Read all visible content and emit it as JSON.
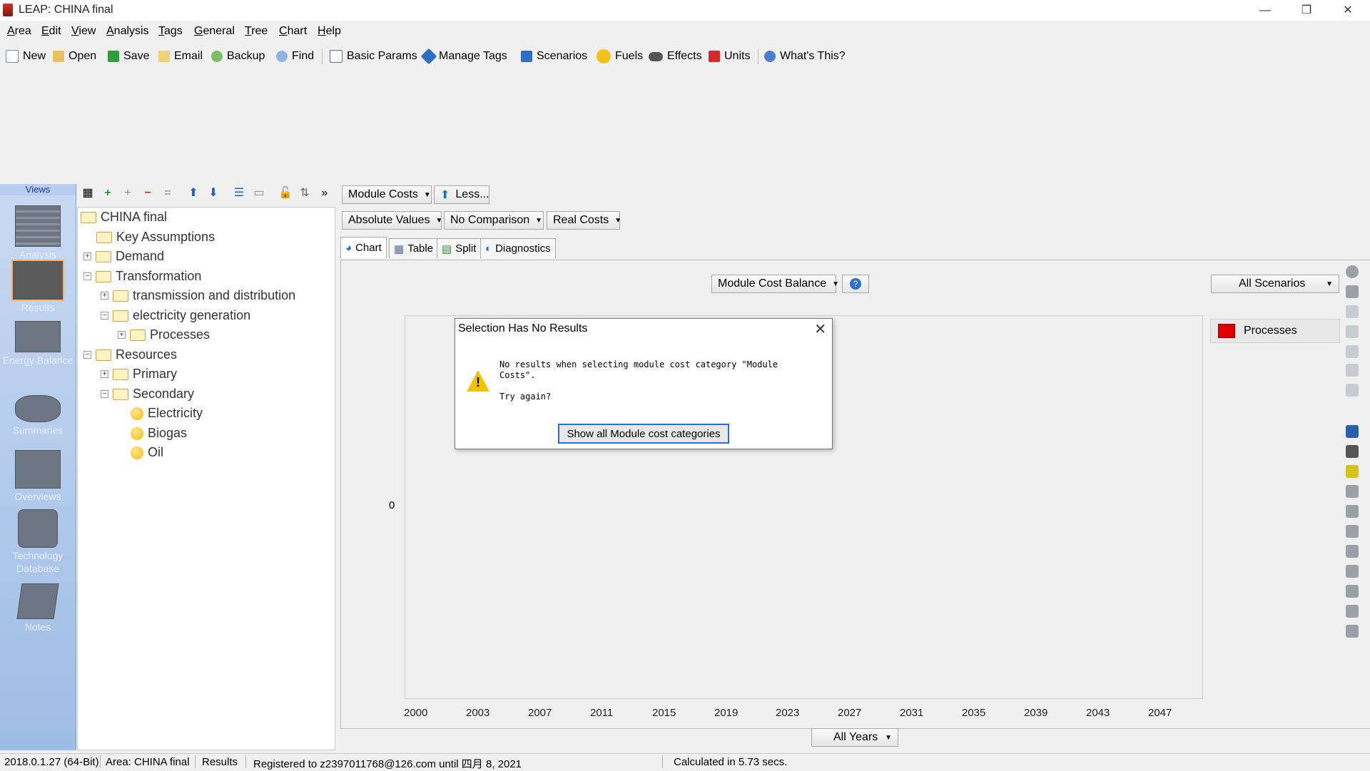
{
  "window": {
    "title": "LEAP: CHINA final",
    "minimize": "—",
    "restore": "❐",
    "close": "✕"
  },
  "menu": [
    "Area",
    "Edit",
    "View",
    "Analysis",
    "Tags",
    "General",
    "Tree",
    "Chart",
    "Help"
  ],
  "toolbar": {
    "new": "New",
    "open": "Open",
    "save": "Save",
    "email": "Email",
    "backup": "Backup",
    "find": "Find",
    "basic_params": "Basic Params",
    "manage_tags": "Manage Tags",
    "scenarios": "Scenarios",
    "fuels": "Fuels",
    "effects": "Effects",
    "units": "Units",
    "whats_this": "What's This?"
  },
  "views": {
    "header": "Views",
    "items": [
      {
        "label": "Analysis",
        "icon": "analysis-icon"
      },
      {
        "label": "Results",
        "icon": "results-icon",
        "selected": true
      },
      {
        "label": "Energy Balance",
        "icon": "energy-balance-icon"
      },
      {
        "label": "Summaries",
        "icon": "summaries-icon"
      },
      {
        "label": "Overviews",
        "icon": "overviews-icon"
      },
      {
        "label": "Technology Database",
        "icon": "technology-database-icon"
      },
      {
        "label": "Notes",
        "icon": "notes-icon"
      }
    ]
  },
  "tree": {
    "root": "CHINA final",
    "key_assumptions": "Key Assumptions",
    "demand": "Demand",
    "transformation": "Transformation",
    "transmission": "transmission and distribution",
    "electricity_generation": "electricity generation",
    "processes": "Processes",
    "resources": "Resources",
    "primary": "Primary",
    "secondary": "Secondary",
    "electricity": "Electricity",
    "biogas": "Biogas",
    "oil": "Oil"
  },
  "controls": {
    "module_costs": "Module Costs",
    "less": "Less...",
    "absolute_values": "Absolute Values",
    "no_comparison": "No Comparison",
    "real_costs": "Real Costs",
    "tabs": {
      "chart": "Chart",
      "table": "Table",
      "split": "Split",
      "diagnostics": "Diagnostics"
    },
    "module_cost_balance": "Module Cost Balance",
    "all_scenarios": "All Scenarios",
    "all_years": "All Years"
  },
  "chart_data": {
    "type": "bar",
    "categories": [
      "2000",
      "2003",
      "2007",
      "2011",
      "2015",
      "2019",
      "2023",
      "2027",
      "2031",
      "2035",
      "2039",
      "2043",
      "2047"
    ],
    "series": [
      {
        "name": "Processes",
        "values": []
      }
    ],
    "y_tick": "0",
    "legend_position": "right",
    "series_color": "#e00000"
  },
  "dialog": {
    "title": "Selection Has No Results",
    "message": "No results when selecting module cost category \"Module\nCosts\".\n\nTry again?",
    "button": "Show all Module cost categories"
  },
  "status": {
    "version": "2018.0.1.27 (64-Bit)",
    "area": "Area: CHINA final",
    "view": "Results",
    "registered": "Registered to z2397011768@126.com until 四月 8, 2021",
    "calc": "Calculated in 5.73 secs."
  }
}
